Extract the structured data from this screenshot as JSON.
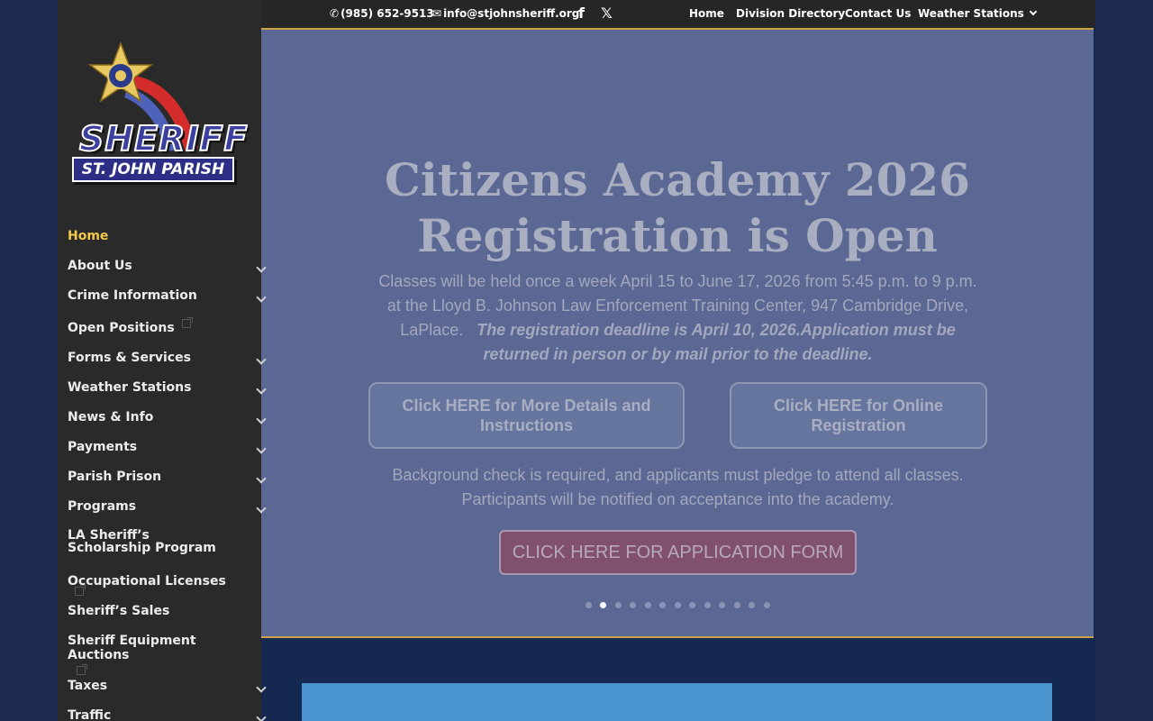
{
  "topbar": {
    "phone": "(985) 652-9513",
    "email": "info@stjohnsheriff.org",
    "social": [
      {
        "name": "facebook-icon",
        "glyph": "f"
      },
      {
        "name": "x-icon",
        "glyph": "𝕏"
      }
    ],
    "menu": [
      {
        "label": "Home"
      },
      {
        "label": "Division Directory"
      },
      {
        "label": "Contact Us"
      },
      {
        "label": "Weather Stations"
      }
    ]
  },
  "logo": {
    "line1": "SHERIFF",
    "line2": "ST. JOHN PARISH"
  },
  "sidebar": {
    "items": [
      {
        "label": "Home",
        "active": true
      },
      {
        "label": "About Us",
        "submenu": true
      },
      {
        "label": "Crime Information",
        "submenu": true
      },
      {
        "label": "Open Positions",
        "external": true
      },
      {
        "label": "Forms & Services",
        "submenu": true
      },
      {
        "label": "Weather Stations",
        "submenu": true
      },
      {
        "label": "News & Info",
        "submenu": true
      },
      {
        "label": "Payments",
        "submenu": true
      },
      {
        "label": "Parish Prison",
        "submenu": true
      },
      {
        "label": "Programs",
        "submenu": true
      },
      {
        "label": "LA Sheriff’s Scholarship Program"
      },
      {
        "label": "Occupational Licenses",
        "external": true
      },
      {
        "label": "Sheriff’s Sales"
      },
      {
        "label": "Sheriff Equipment Auctions",
        "external": true
      },
      {
        "label": "Taxes",
        "submenu": true
      },
      {
        "label": "Traffic",
        "submenu": true
      }
    ]
  },
  "hero": {
    "title_line1": "Citizens Academy 2026",
    "title_line2": "Registration is Open",
    "body": "Classes will be held once a week April 15 to June 17, 2026 from 5:45 p.m. to 9 p.m. at the Lloyd B. Johnson Law Enforcement Training Center, 947 Cambridge Drive, LaPlace.",
    "body_emphasis": "The registration deadline is April 10, 2026.Application must be returned in person or by mail prior to the deadline.",
    "btn_details": "Click HERE for More Details and Instructions",
    "btn_online": "Click HERE for Online Registration",
    "note": "Background check is required, and applicants must pledge to attend all classes. Participants will be notified on acceptance into the academy.",
    "app_button": "CLICK HERE FOR APPLICATION FORM",
    "slide_count": 13,
    "active_slide": 2
  },
  "colors": {
    "sidebar_bg": "#2a2a2a",
    "hero_bg": "#5a6893",
    "accent_gold": "#f2c94c",
    "app_button_bg": "#80506e",
    "lower_box": "#4a94cf"
  }
}
